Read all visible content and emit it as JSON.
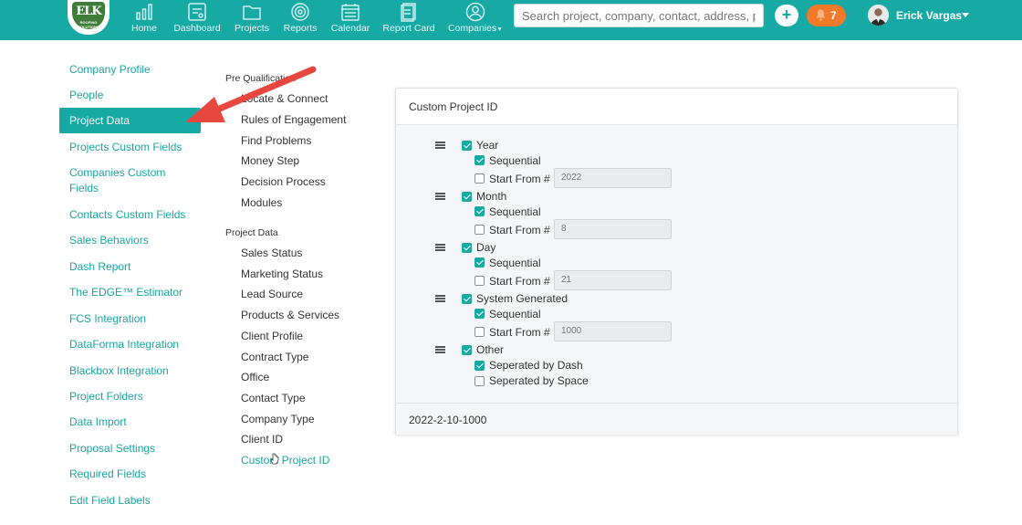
{
  "header": {
    "logo_text": "ELK",
    "logo_subtext": "ROOFING SOLUTIONS",
    "nav": [
      {
        "label": "Home",
        "icon": "bar-chart-icon"
      },
      {
        "label": "Dashboard",
        "icon": "dashboard-icon"
      },
      {
        "label": "Projects",
        "icon": "folder-icon"
      },
      {
        "label": "Reports",
        "icon": "target-icon"
      },
      {
        "label": "Calendar",
        "icon": "calendar-icon"
      },
      {
        "label": "Report Card",
        "icon": "report-card-icon"
      },
      {
        "label": "Companies",
        "icon": "person-icon"
      }
    ],
    "search_placeholder": "Search project, company, contact, address, phc",
    "plus_label": "+",
    "notification_count": "7",
    "user_name": "Erick Vargas"
  },
  "sidebar": {
    "items": [
      {
        "label": "Company Profile"
      },
      {
        "label": "People"
      },
      {
        "label": "Project Data",
        "active": true
      },
      {
        "label": "Projects Custom Fields"
      },
      {
        "label": "Companies Custom Fields"
      },
      {
        "label": "Contacts Custom Fields"
      },
      {
        "label": "Sales Behaviors"
      },
      {
        "label": "Dash Report"
      },
      {
        "label": "The EDGE™ Estimator"
      },
      {
        "label": "FCS Integration"
      },
      {
        "label": "DataForma Integration"
      },
      {
        "label": "Blackbox Integration"
      },
      {
        "label": "Project Folders"
      },
      {
        "label": "Data Import"
      },
      {
        "label": "Proposal Settings"
      },
      {
        "label": "Required Fields"
      },
      {
        "label": "Edit Field Labels"
      }
    ]
  },
  "middle_menu": {
    "sections": [
      {
        "header": "Pre Qualification",
        "items": [
          "Locate & Connect",
          "Rules of Engagement",
          "Find Problems",
          "Money Step",
          "Decision Process",
          "Modules"
        ]
      },
      {
        "header": "Project Data",
        "items": [
          "Sales Status",
          "Marketing Status",
          "Lead Source",
          "Products & Services",
          "Client Profile",
          "Contract Type",
          "Office",
          "Contact Type",
          "Company Type",
          "Client ID",
          "Custom Project ID"
        ]
      }
    ],
    "current": "Custom Project ID"
  },
  "card": {
    "title": "Custom Project ID",
    "groups": [
      {
        "label": "Year",
        "checked": true,
        "sequential_label": "Sequential",
        "sequential_checked": true,
        "start_label": "Start From #",
        "start_checked": false,
        "start_value": "2022"
      },
      {
        "label": "Month",
        "checked": true,
        "sequential_label": "Sequential",
        "sequential_checked": true,
        "start_label": "Start From #",
        "start_checked": false,
        "start_value": "8"
      },
      {
        "label": "Day",
        "checked": true,
        "sequential_label": "Sequential",
        "sequential_checked": true,
        "start_label": "Start From #",
        "start_checked": false,
        "start_value": "21"
      },
      {
        "label": "System Generated",
        "checked": true,
        "sequential_label": "Sequential",
        "sequential_checked": true,
        "start_label": "Start From #",
        "start_checked": false,
        "start_value": "1000"
      }
    ],
    "other": {
      "label": "Other",
      "checked": true,
      "options": [
        {
          "label": "Seperated by Dash",
          "checked": true
        },
        {
          "label": "Seperated by Space",
          "checked": false
        }
      ]
    },
    "result": "2022-2-10-1000"
  },
  "colors": {
    "brand": "#17a9a4",
    "notification": "#f07a2a",
    "annotation_arrow": "#e8473f"
  }
}
